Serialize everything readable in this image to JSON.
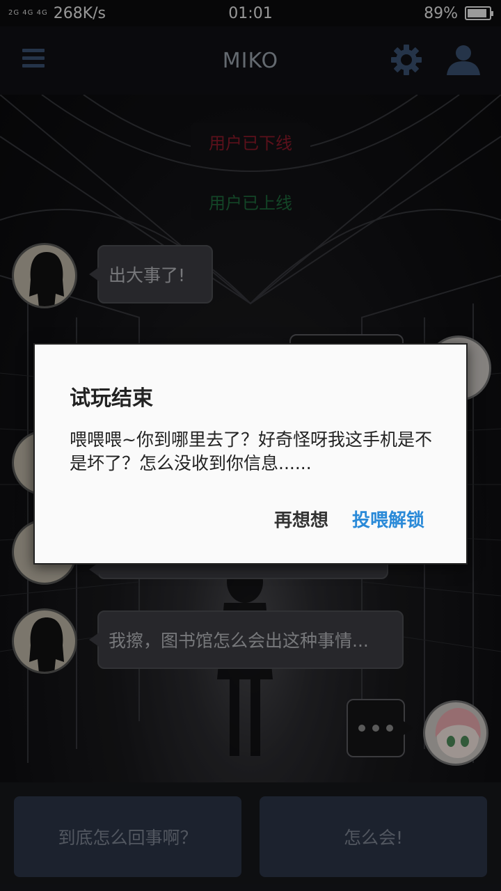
{
  "status_bar": {
    "signal_text": "2G 4G 4G",
    "network_speed": "268K/s",
    "time": "01:01",
    "battery_percent": "89%",
    "battery_level": 0.89
  },
  "app_bar": {
    "title": "MIKO",
    "menu_icon": "hamburger-icon",
    "settings_icon": "gear-icon",
    "profile_icon": "user-icon",
    "accent_color": "#3a5070"
  },
  "chat": {
    "system_messages": [
      {
        "text": "用户已下线",
        "color": "#8c1a2a"
      },
      {
        "text": "用户已上线",
        "color": "#1e6a3c"
      }
    ],
    "messages": [
      {
        "sender": "contact",
        "text": "出大事了!"
      },
      {
        "sender": "contact",
        "text": "我擦，图书馆怎么会出这种事情..."
      },
      {
        "sender": "me",
        "text": "• • •"
      }
    ]
  },
  "dialog": {
    "title": "试玩结束",
    "message": "喂喂喂~你到哪里去了？好奇怪呀我这手机是不是坏了？怎么没收到你信息......",
    "cancel_label": "再想想",
    "confirm_label": "投喂解锁",
    "confirm_color": "#2a8ad8"
  },
  "replies": [
    {
      "label": "到底怎么回事啊？"
    },
    {
      "label": "怎么会!"
    }
  ]
}
